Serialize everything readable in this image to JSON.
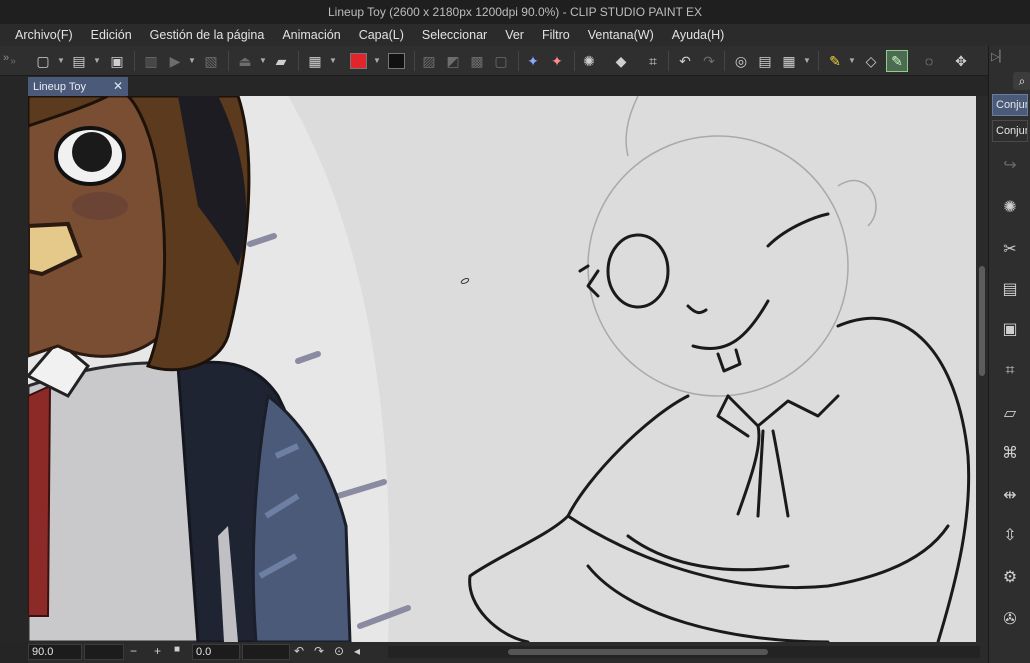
{
  "window": {
    "title": "Lineup Toy (2600 x 2180px 1200dpi 90.0%)  - CLIP STUDIO PAINT EX"
  },
  "menu": {
    "items": [
      "Archivo(F)",
      "Edición",
      "Gestión de la página",
      "Animación",
      "Capa(L)",
      "Seleccionar",
      "Ver",
      "Filtro",
      "Ventana(W)",
      "Ayuda(H)"
    ]
  },
  "toolbar": {
    "main_color": "#e0262a",
    "sub_color": "#111111"
  },
  "tab": {
    "label": "Lineup Toy",
    "close_glyph": "✕"
  },
  "status": {
    "zoom": "90.0",
    "rotation": "0.0"
  },
  "right_panel": {
    "buttons": [
      "Conjunto",
      "Conjunto"
    ]
  }
}
